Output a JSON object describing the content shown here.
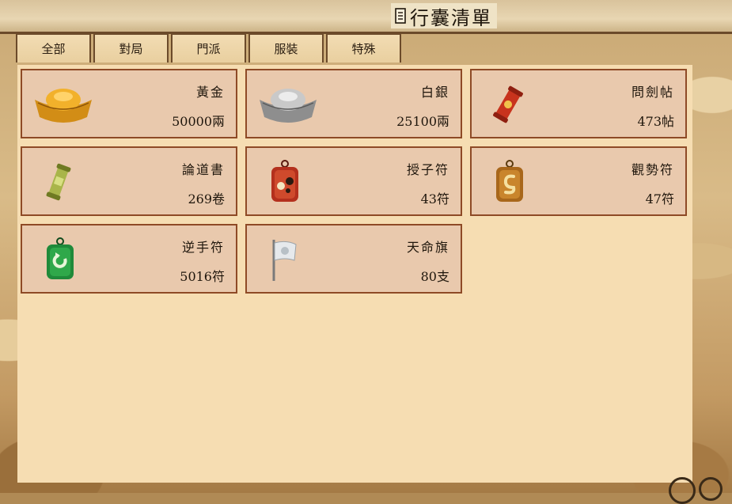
{
  "header": {
    "title": "行囊清單",
    "title_icon": "scroll-list-icon"
  },
  "tabs": [
    {
      "label": "全部"
    },
    {
      "label": "對局"
    },
    {
      "label": "門派"
    },
    {
      "label": "服裝"
    },
    {
      "label": "特殊"
    }
  ],
  "items": [
    {
      "name": "黃金",
      "quantity": "50000兩",
      "icon": "gold-ingot-icon"
    },
    {
      "name": "白銀",
      "quantity": "25100兩",
      "icon": "silver-ingot-icon"
    },
    {
      "name": "問劍帖",
      "quantity": "473帖",
      "icon": "red-scroll-icon"
    },
    {
      "name": "論道書",
      "quantity": "269卷",
      "icon": "green-scroll-icon"
    },
    {
      "name": "授子符",
      "quantity": "43符",
      "icon": "red-talisman-icon"
    },
    {
      "name": "觀勢符",
      "quantity": "47符",
      "icon": "gold-talisman-icon"
    },
    {
      "name": "逆手符",
      "quantity": "5016符",
      "icon": "green-talisman-icon"
    },
    {
      "name": "天命旗",
      "quantity": "80支",
      "icon": "white-flag-icon"
    }
  ],
  "colors": {
    "panel": "#f6ddb2",
    "card": "#e9c9ad",
    "card_border": "#8e4a26",
    "frame": "#6b4a2a"
  }
}
